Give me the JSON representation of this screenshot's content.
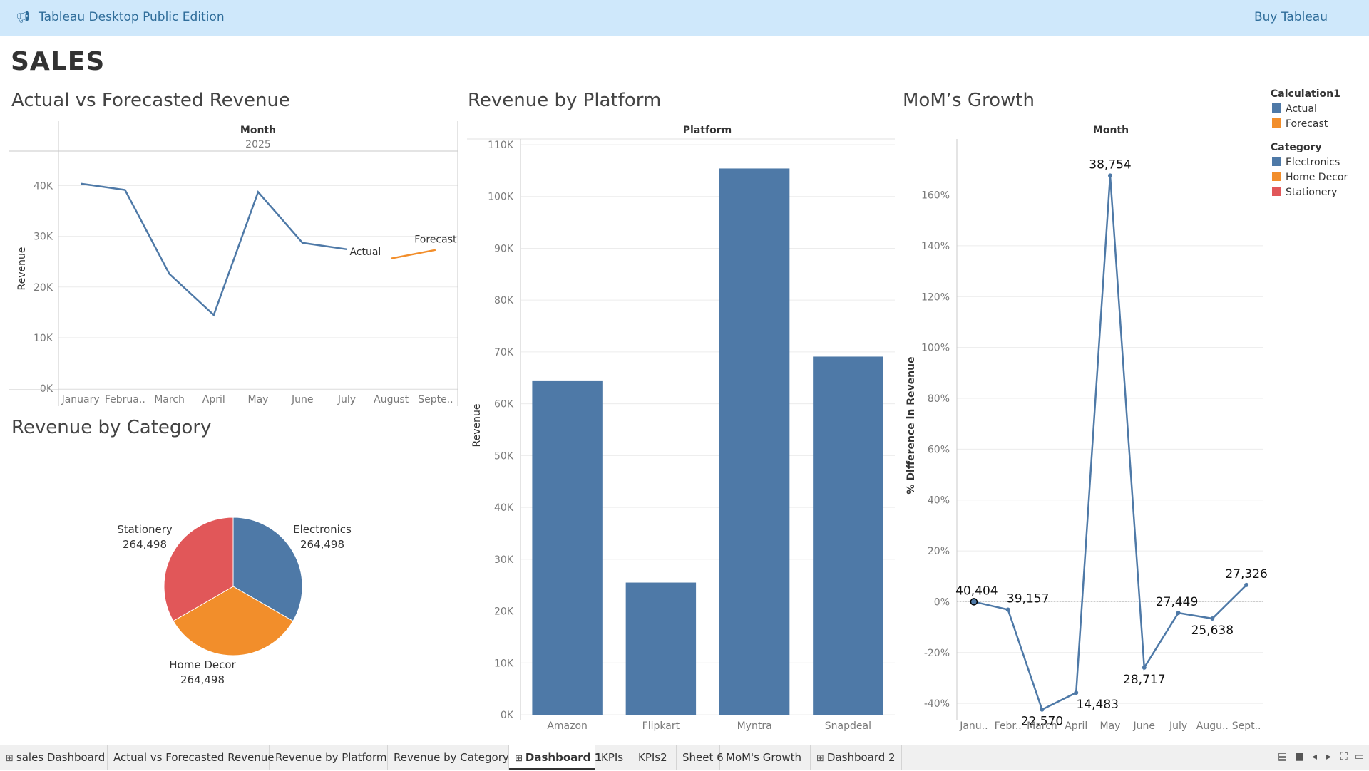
{
  "app": {
    "title": "Tableau Desktop Public Edition",
    "buy_label": "Buy Tableau"
  },
  "dashboard": {
    "title": "SALES"
  },
  "sheets": {
    "actual_vs_forecast": "Actual vs Forecasted Revenue",
    "by_platform": "Revenue by Platform",
    "mom_growth": "MoM’s Growth",
    "by_category": "Revenue by Category"
  },
  "legend": {
    "calc_title": "Calculation1",
    "calc_items": [
      {
        "label": "Actual",
        "color": "#4e79a7"
      },
      {
        "label": "Forecast",
        "color": "#f28e2b"
      }
    ],
    "cat_title": "Category",
    "cat_items": [
      {
        "label": "Electronics",
        "color": "#4e79a7"
      },
      {
        "label": "Home Decor",
        "color": "#f28e2b"
      },
      {
        "label": "Stationery",
        "color": "#e15759"
      }
    ]
  },
  "chart_data": [
    {
      "type": "line",
      "title": "Actual vs Forecasted Revenue",
      "header": "Month",
      "subheader": "2025",
      "ylabel": "Revenue",
      "ylim": [
        0,
        45000
      ],
      "y_ticks": [
        "0K",
        "10K",
        "20K",
        "30K",
        "40K"
      ],
      "y_tick_values": [
        0,
        10000,
        20000,
        30000,
        40000
      ],
      "categories": [
        "January",
        "Februa..",
        "March",
        "April",
        "May",
        "June",
        "July",
        "August",
        "Septe.."
      ],
      "series": [
        {
          "name": "Actual",
          "color": "#4e79a7",
          "values": [
            40404,
            39157,
            22570,
            14483,
            38754,
            28717,
            27449,
            null,
            null
          ]
        },
        {
          "name": "Forecast",
          "color": "#f28e2b",
          "values": [
            null,
            null,
            null,
            null,
            null,
            null,
            null,
            25638,
            27326
          ]
        }
      ]
    },
    {
      "type": "bar",
      "title": "Revenue by Platform",
      "header": "Platform",
      "ylabel": "Revenue",
      "ylim": [
        0,
        110000
      ],
      "y_ticks": [
        "0K",
        "10K",
        "20K",
        "30K",
        "40K",
        "50K",
        "60K",
        "70K",
        "80K",
        "90K",
        "100K",
        "110K"
      ],
      "y_tick_values": [
        0,
        10000,
        20000,
        30000,
        40000,
        50000,
        60000,
        70000,
        80000,
        90000,
        100000,
        110000
      ],
      "categories": [
        "Amazon",
        "Flipkart",
        "Myntra",
        "Snapdeal"
      ],
      "values": [
        64500,
        25500,
        105400,
        69100
      ],
      "color": "#4e79a7"
    },
    {
      "type": "line",
      "title": "MoM’s Growth",
      "header": "Month",
      "ylabel": "% Difference in Revenue",
      "ylim": [
        -45,
        175
      ],
      "y_ticks": [
        "-40%",
        "-20%",
        "0%",
        "20%",
        "40%",
        "60%",
        "80%",
        "100%",
        "120%",
        "140%",
        "160%"
      ],
      "y_tick_values": [
        -40,
        -20,
        0,
        20,
        40,
        60,
        80,
        100,
        120,
        140,
        160
      ],
      "categories": [
        "Janu..",
        "Febr..",
        "March",
        "April",
        "May",
        "June",
        "July",
        "Augu..",
        "Sept.."
      ],
      "values": [
        0,
        -3.1,
        -42.4,
        -35.8,
        167.6,
        -25.9,
        -4.4,
        -6.6,
        6.6
      ],
      "data_labels": [
        "40,404",
        "39,157",
        "22,570",
        "14,483",
        "38,754",
        "28,717",
        "27,449",
        "25,638",
        "27,326"
      ],
      "color": "#4e79a7"
    },
    {
      "type": "pie",
      "title": "Revenue by Category",
      "slices": [
        {
          "label": "Electronics",
          "value": 264498,
          "value_label": "264,498",
          "color": "#4e79a7"
        },
        {
          "label": "Home Decor",
          "value": 264498,
          "value_label": "264,498",
          "color": "#f28e2b"
        },
        {
          "label": "Stationery",
          "value": 264498,
          "value_label": "264,498",
          "color": "#e15759"
        }
      ]
    }
  ],
  "tabs": [
    {
      "label": "sales Dashboard",
      "icon": "dashboard-icon",
      "active": false
    },
    {
      "label": "Actual vs Forecasted Revenue",
      "icon": "",
      "active": false
    },
    {
      "label": "Revenue by Platform",
      "icon": "",
      "active": false
    },
    {
      "label": "Revenue by Category",
      "icon": "",
      "active": false
    },
    {
      "label": "Dashboard 1",
      "icon": "dashboard-icon",
      "active": true
    },
    {
      "label": "KPIs",
      "icon": "",
      "active": false
    },
    {
      "label": "KPIs2",
      "icon": "",
      "active": false
    },
    {
      "label": "Sheet 6",
      "icon": "",
      "active": false
    },
    {
      "label": "MoM's Growth",
      "icon": "",
      "active": false
    },
    {
      "label": "Dashboard 2",
      "icon": "dashboard-icon",
      "active": false
    }
  ]
}
